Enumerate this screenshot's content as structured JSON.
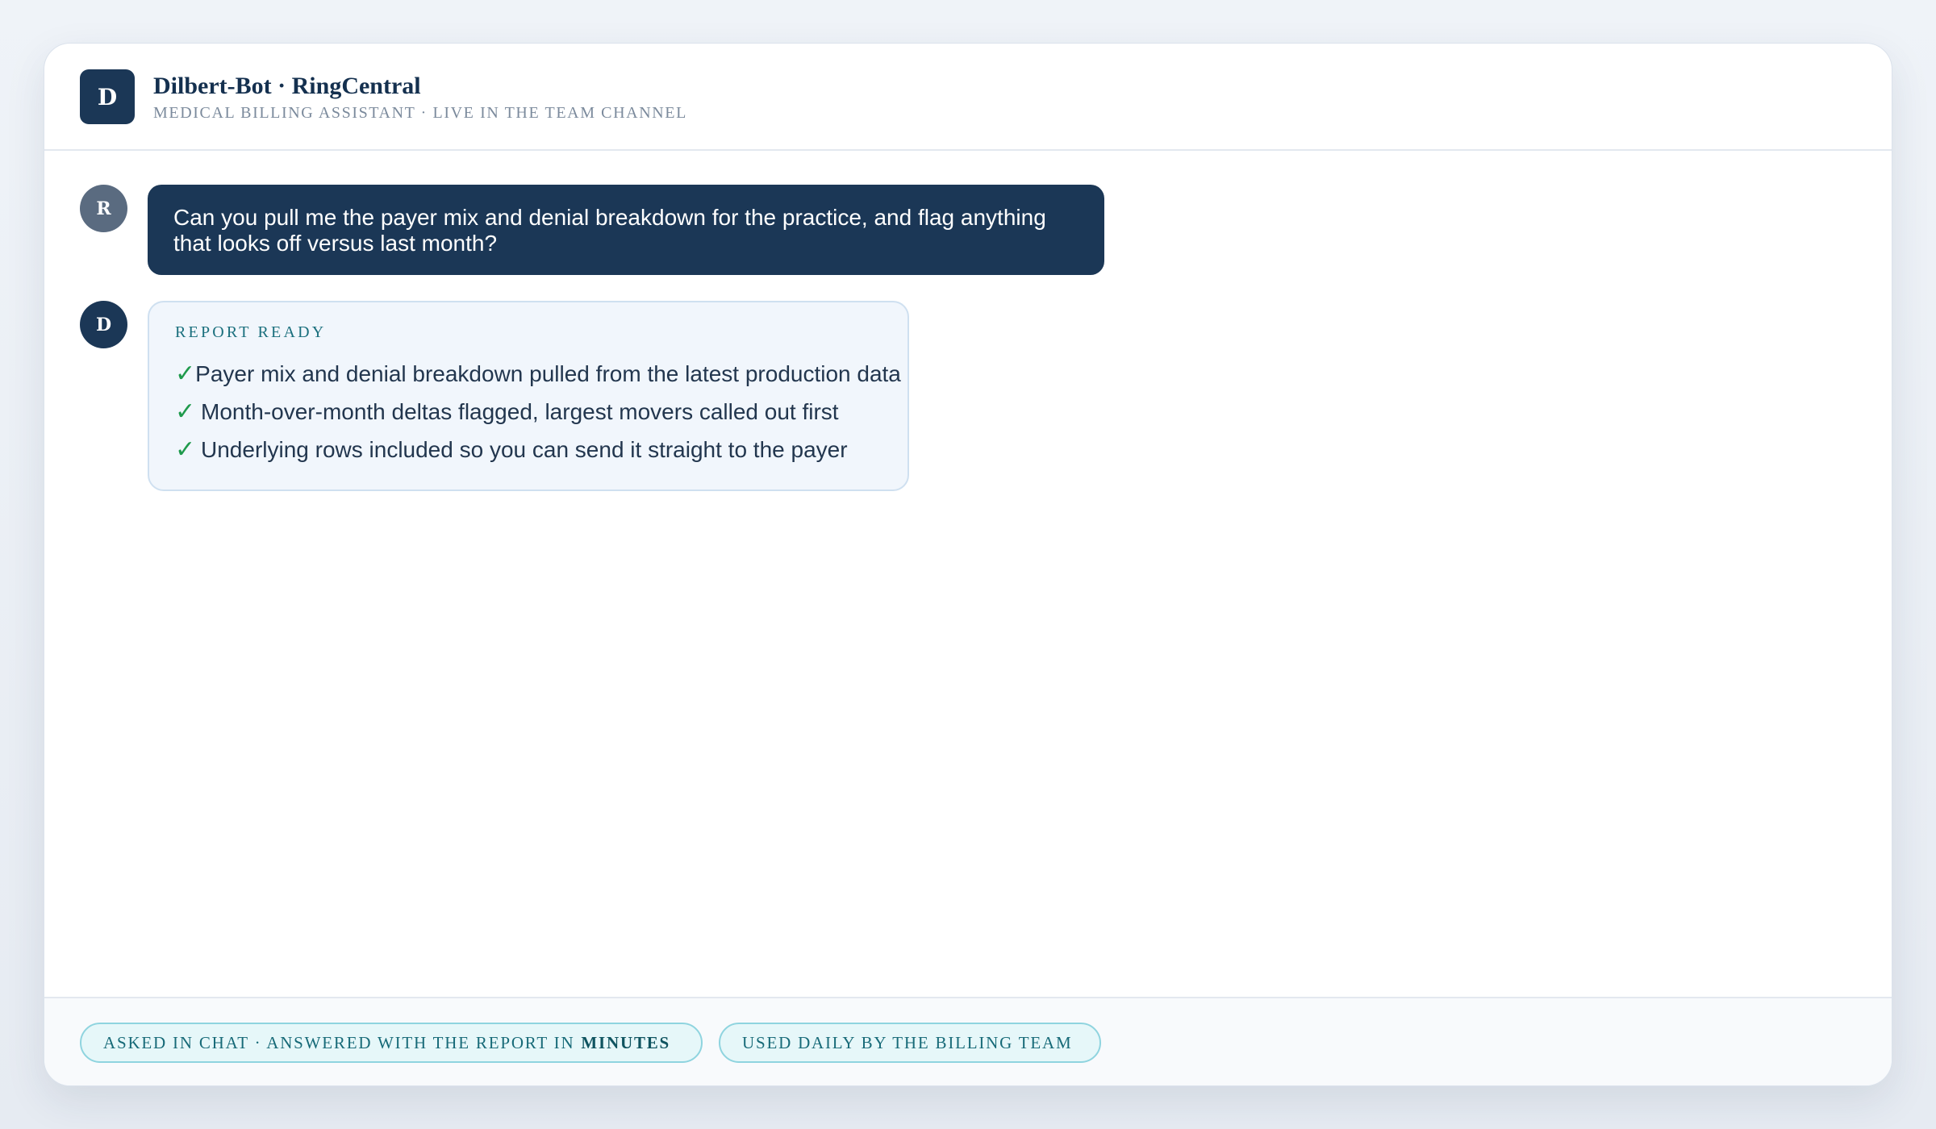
{
  "header": {
    "logo_letter": "D",
    "title": "Dilbert-Bot · RingCentral",
    "subtitle": "MEDICAL BILLING ASSISTANT · LIVE IN THE TEAM CHANNEL"
  },
  "messages": {
    "user": {
      "avatar_letter": "R",
      "text": "Can you pull me the payer mix and denial breakdown for the practice, and flag anything that looks off versus last month?"
    },
    "bot": {
      "avatar_letter": "D",
      "report_label": "REPORT READY",
      "items": [
        "Payer mix and denial breakdown pulled from the latest production data",
        "Month-over-month deltas flagged, largest movers called out first",
        "Underlying rows included so you can send it straight to the payer"
      ],
      "check_glyph": "✓"
    }
  },
  "footer": {
    "pills": [
      {
        "text": "ASKED IN CHAT · ANSWERED WITH THE REPORT IN",
        "emphasis": "MINUTES"
      },
      {
        "text": "USED DAILY BY THE BILLING TEAM"
      }
    ]
  },
  "colors": {
    "navy": "#1b3756",
    "check_green": "#1f9a4c",
    "teal": "#176a78",
    "user_avatar": "#5a6b80"
  }
}
